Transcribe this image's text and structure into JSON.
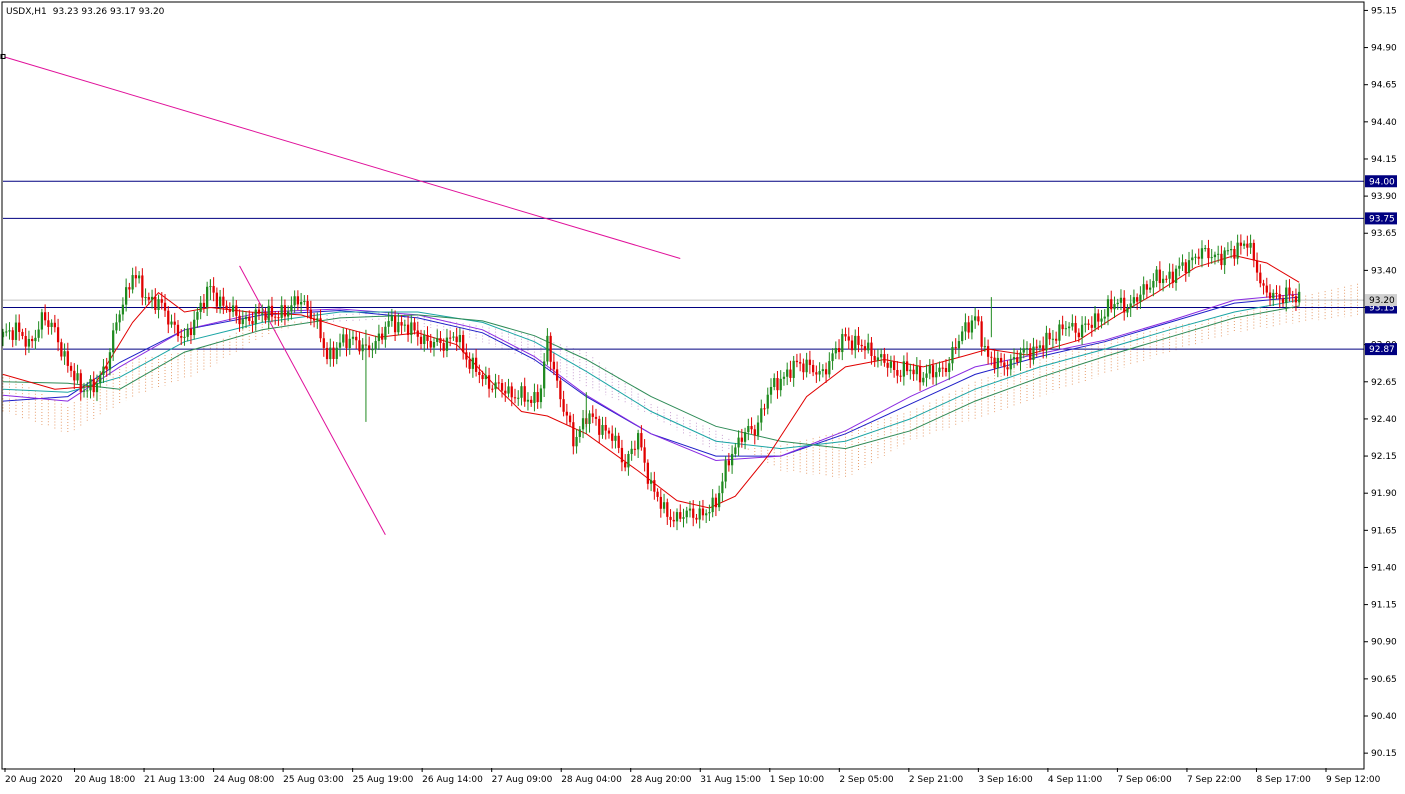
{
  "window": {
    "symbol_timeframe": "USDX,H1",
    "ohlc_readout": "93.23 93.26 93.17 93.20"
  },
  "colors": {
    "bull_candle": "#1f8a1f",
    "bear_candle": "#e00000",
    "hline": "#000080",
    "trendline": "#e0109a",
    "sma_fast": "#e00000",
    "ma_blue": "#1e1ec8",
    "ma_purple": "#8a2be2",
    "ma_teal": "#1aa5a5",
    "ma_green": "#2e8b57",
    "cloud_bull": "#e8a070",
    "cloud_bear": "#c8a0d0",
    "grid_current_price": "#c0c0c0"
  },
  "chart_data": {
    "type": "candlestick",
    "title": "USDX,H1",
    "ylim": [
      90.05,
      95.2
    ],
    "y_ticks": [
      "95.15",
      "94.90",
      "94.65",
      "94.40",
      "94.15",
      "93.90",
      "93.65",
      "93.40",
      "93.15",
      "92.90",
      "92.65",
      "92.40",
      "92.15",
      "91.90",
      "91.65",
      "91.40",
      "91.15",
      "90.90",
      "90.65",
      "90.40",
      "90.15"
    ],
    "x_ticks": [
      "20 Aug 2020",
      "20 Aug 18:00",
      "21 Aug 13:00",
      "24 Aug 08:00",
      "25 Aug 03:00",
      "25 Aug 19:00",
      "26 Aug 14:00",
      "27 Aug 09:00",
      "28 Aug 04:00",
      "28 Aug 20:00",
      "31 Aug 15:00",
      "1 Sep 10:00",
      "2 Sep 05:00",
      "2 Sep 21:00",
      "3 Sep 16:00",
      "4 Sep 11:00",
      "7 Sep 06:00",
      "7 Sep 22:00",
      "8 Sep 17:00",
      "9 Sep 12:00"
    ],
    "price_levels": [
      {
        "label": "94.00",
        "value": 94.0
      },
      {
        "label": "93.75",
        "value": 93.75
      },
      {
        "label": "93.15",
        "value": 93.15
      },
      {
        "label": "92.87",
        "value": 92.87
      }
    ],
    "current_price": {
      "label": "93.20",
      "value": 93.2
    },
    "trendlines": [
      {
        "from": [
          0,
          94.84
        ],
        "to": [
          209,
          93.48
        ]
      },
      {
        "from": [
          73,
          93.43
        ],
        "to": [
          118,
          91.62
        ]
      }
    ],
    "close_path": [
      [
        0,
        92.95
      ],
      [
        4,
        93.02
      ],
      [
        8,
        92.88
      ],
      [
        12,
        93.08
      ],
      [
        16,
        93.0
      ],
      [
        20,
        92.75
      ],
      [
        24,
        92.62
      ],
      [
        28,
        92.6
      ],
      [
        32,
        92.78
      ],
      [
        36,
        93.12
      ],
      [
        40,
        93.38
      ],
      [
        44,
        93.22
      ],
      [
        48,
        93.18
      ],
      [
        52,
        93.05
      ],
      [
        56,
        92.92
      ],
      [
        60,
        93.12
      ],
      [
        64,
        93.28
      ],
      [
        68,
        93.16
      ],
      [
        72,
        93.1
      ],
      [
        76,
        93.05
      ],
      [
        80,
        93.13
      ],
      [
        84,
        93.08
      ],
      [
        88,
        93.15
      ],
      [
        92,
        93.2
      ],
      [
        96,
        93.08
      ],
      [
        100,
        92.82
      ],
      [
        104,
        92.9
      ],
      [
        108,
        92.95
      ],
      [
        112,
        92.85
      ],
      [
        116,
        92.95
      ],
      [
        120,
        93.06
      ],
      [
        124,
        93.02
      ],
      [
        128,
        92.97
      ],
      [
        132,
        92.9
      ],
      [
        136,
        92.92
      ],
      [
        140,
        92.95
      ],
      [
        144,
        92.78
      ],
      [
        148,
        92.67
      ],
      [
        152,
        92.62
      ],
      [
        156,
        92.58
      ],
      [
        160,
        92.55
      ],
      [
        163,
        92.52
      ],
      [
        166,
        92.6
      ],
      [
        168,
        92.92
      ],
      [
        172,
        92.55
      ],
      [
        176,
        92.25
      ],
      [
        180,
        92.42
      ],
      [
        184,
        92.36
      ],
      [
        188,
        92.28
      ],
      [
        192,
        92.1
      ],
      [
        196,
        92.27
      ],
      [
        200,
        91.95
      ],
      [
        204,
        91.78
      ],
      [
        208,
        91.72
      ],
      [
        212,
        91.78
      ],
      [
        216,
        91.74
      ],
      [
        220,
        91.85
      ],
      [
        224,
        92.12
      ],
      [
        228,
        92.3
      ],
      [
        232,
        92.32
      ],
      [
        236,
        92.57
      ],
      [
        240,
        92.67
      ],
      [
        244,
        92.75
      ],
      [
        248,
        92.78
      ],
      [
        252,
        92.68
      ],
      [
        256,
        92.83
      ],
      [
        260,
        92.95
      ],
      [
        264,
        92.9
      ],
      [
        268,
        92.85
      ],
      [
        272,
        92.78
      ],
      [
        276,
        92.72
      ],
      [
        280,
        92.73
      ],
      [
        284,
        92.69
      ],
      [
        288,
        92.72
      ],
      [
        292,
        92.77
      ],
      [
        296,
        93.0
      ],
      [
        300,
        93.07
      ],
      [
        304,
        92.82
      ],
      [
        308,
        92.75
      ],
      [
        312,
        92.8
      ],
      [
        316,
        92.86
      ],
      [
        320,
        92.88
      ],
      [
        324,
        92.96
      ],
      [
        328,
        93.02
      ],
      [
        332,
        93.0
      ],
      [
        336,
        93.04
      ],
      [
        340,
        93.12
      ],
      [
        344,
        93.19
      ],
      [
        348,
        93.15
      ],
      [
        352,
        93.28
      ],
      [
        356,
        93.34
      ],
      [
        360,
        93.36
      ],
      [
        364,
        93.42
      ],
      [
        368,
        93.5
      ],
      [
        372,
        93.52
      ],
      [
        376,
        93.48
      ],
      [
        380,
        93.55
      ],
      [
        384,
        93.58
      ],
      [
        387,
        93.42
      ],
      [
        389,
        93.26
      ],
      [
        392,
        93.22
      ],
      [
        396,
        93.24
      ],
      [
        400,
        93.2
      ]
    ],
    "spikes": [
      [
        112,
        93.0,
        92.38
      ],
      [
        64,
        93.34,
        93.2
      ],
      [
        180,
        92.58,
        92.3
      ],
      [
        305,
        93.22,
        92.95
      ]
    ],
    "sma_fast_path": [
      [
        0,
        92.7
      ],
      [
        16,
        92.6
      ],
      [
        28,
        92.62
      ],
      [
        40,
        93.05
      ],
      [
        48,
        93.25
      ],
      [
        56,
        93.12
      ],
      [
        64,
        93.15
      ],
      [
        76,
        93.12
      ],
      [
        92,
        93.1
      ],
      [
        104,
        93.02
      ],
      [
        116,
        92.95
      ],
      [
        128,
        92.98
      ],
      [
        140,
        92.9
      ],
      [
        152,
        92.62
      ],
      [
        160,
        92.45
      ],
      [
        168,
        92.42
      ],
      [
        180,
        92.3
      ],
      [
        196,
        92.05
      ],
      [
        208,
        91.85
      ],
      [
        218,
        91.8
      ],
      [
        226,
        91.88
      ],
      [
        236,
        92.15
      ],
      [
        248,
        92.55
      ],
      [
        260,
        92.75
      ],
      [
        272,
        92.8
      ],
      [
        284,
        92.75
      ],
      [
        296,
        92.82
      ],
      [
        304,
        92.87
      ],
      [
        316,
        92.83
      ],
      [
        332,
        92.93
      ],
      [
        344,
        93.1
      ],
      [
        356,
        93.25
      ],
      [
        368,
        93.42
      ],
      [
        380,
        93.5
      ],
      [
        390,
        93.45
      ],
      [
        400,
        93.32
      ]
    ],
    "ma_lines": [
      {
        "color_key": "ma_blue",
        "points": [
          [
            0,
            92.52
          ],
          [
            20,
            92.55
          ],
          [
            36,
            92.78
          ],
          [
            56,
            93.0
          ],
          [
            80,
            93.1
          ],
          [
            104,
            93.13
          ],
          [
            128,
            93.08
          ],
          [
            148,
            92.98
          ],
          [
            164,
            92.8
          ],
          [
            180,
            92.55
          ],
          [
            200,
            92.3
          ],
          [
            220,
            92.15
          ],
          [
            240,
            92.15
          ],
          [
            260,
            92.3
          ],
          [
            280,
            92.5
          ],
          [
            300,
            92.7
          ],
          [
            320,
            92.82
          ],
          [
            340,
            92.92
          ],
          [
            360,
            93.05
          ],
          [
            380,
            93.18
          ],
          [
            400,
            93.22
          ]
        ]
      },
      {
        "color_key": "ma_purple",
        "points": [
          [
            0,
            92.56
          ],
          [
            20,
            92.52
          ],
          [
            36,
            92.75
          ],
          [
            56,
            93.0
          ],
          [
            80,
            93.12
          ],
          [
            104,
            93.14
          ],
          [
            128,
            93.1
          ],
          [
            148,
            93.0
          ],
          [
            164,
            92.82
          ],
          [
            180,
            92.56
          ],
          [
            200,
            92.3
          ],
          [
            220,
            92.12
          ],
          [
            240,
            92.15
          ],
          [
            260,
            92.32
          ],
          [
            280,
            92.55
          ],
          [
            300,
            92.75
          ],
          [
            320,
            92.84
          ],
          [
            340,
            92.93
          ],
          [
            360,
            93.06
          ],
          [
            380,
            93.2
          ],
          [
            400,
            93.24
          ]
        ]
      },
      {
        "color_key": "ma_teal",
        "points": [
          [
            0,
            92.6
          ],
          [
            20,
            92.58
          ],
          [
            36,
            92.68
          ],
          [
            56,
            92.92
          ],
          [
            80,
            93.05
          ],
          [
            104,
            93.12
          ],
          [
            128,
            93.12
          ],
          [
            148,
            93.05
          ],
          [
            164,
            92.92
          ],
          [
            180,
            92.72
          ],
          [
            200,
            92.45
          ],
          [
            220,
            92.25
          ],
          [
            240,
            92.2
          ],
          [
            260,
            92.25
          ],
          [
            280,
            92.4
          ],
          [
            300,
            92.6
          ],
          [
            320,
            92.75
          ],
          [
            340,
            92.87
          ],
          [
            360,
            93.0
          ],
          [
            380,
            93.12
          ],
          [
            400,
            93.2
          ]
        ]
      },
      {
        "color_key": "ma_green",
        "points": [
          [
            0,
            92.65
          ],
          [
            20,
            92.64
          ],
          [
            36,
            92.6
          ],
          [
            56,
            92.85
          ],
          [
            80,
            93.0
          ],
          [
            104,
            93.08
          ],
          [
            128,
            93.1
          ],
          [
            148,
            93.06
          ],
          [
            164,
            92.96
          ],
          [
            180,
            92.8
          ],
          [
            200,
            92.55
          ],
          [
            220,
            92.35
          ],
          [
            240,
            92.25
          ],
          [
            260,
            92.2
          ],
          [
            280,
            92.32
          ],
          [
            300,
            92.52
          ],
          [
            320,
            92.68
          ],
          [
            340,
            92.82
          ],
          [
            360,
            92.95
          ],
          [
            380,
            93.08
          ],
          [
            400,
            93.16
          ]
        ]
      }
    ],
    "cloud": {
      "span_a": [
        [
          0,
          92.7
        ],
        [
          20,
          92.48
        ],
        [
          40,
          92.8
        ],
        [
          60,
          92.86
        ],
        [
          80,
          93.06
        ],
        [
          100,
          93.05
        ],
        [
          120,
          93.06
        ],
        [
          140,
          92.98
        ],
        [
          160,
          92.82
        ],
        [
          180,
          92.62
        ],
        [
          200,
          92.42
        ],
        [
          220,
          92.18
        ],
        [
          240,
          92.22
        ],
        [
          260,
          92.32
        ],
        [
          280,
          92.45
        ],
        [
          300,
          92.65
        ],
        [
          320,
          92.8
        ],
        [
          340,
          92.92
        ],
        [
          360,
          93.02
        ],
        [
          380,
          93.1
        ],
        [
          400,
          93.22
        ],
        [
          420,
          93.32
        ]
      ],
      "span_b": [
        [
          0,
          92.45
        ],
        [
          20,
          92.3
        ],
        [
          40,
          92.55
        ],
        [
          60,
          92.7
        ],
        [
          80,
          92.95
        ],
        [
          100,
          93.1
        ],
        [
          120,
          93.12
        ],
        [
          140,
          93.05
        ],
        [
          160,
          92.98
        ],
        [
          180,
          92.85
        ],
        [
          200,
          92.5
        ],
        [
          220,
          92.32
        ],
        [
          240,
          92.05
        ],
        [
          260,
          92.0
        ],
        [
          280,
          92.25
        ],
        [
          300,
          92.4
        ],
        [
          320,
          92.55
        ],
        [
          340,
          92.7
        ],
        [
          360,
          92.85
        ],
        [
          380,
          92.98
        ],
        [
          400,
          93.05
        ],
        [
          420,
          93.1
        ]
      ]
    }
  }
}
